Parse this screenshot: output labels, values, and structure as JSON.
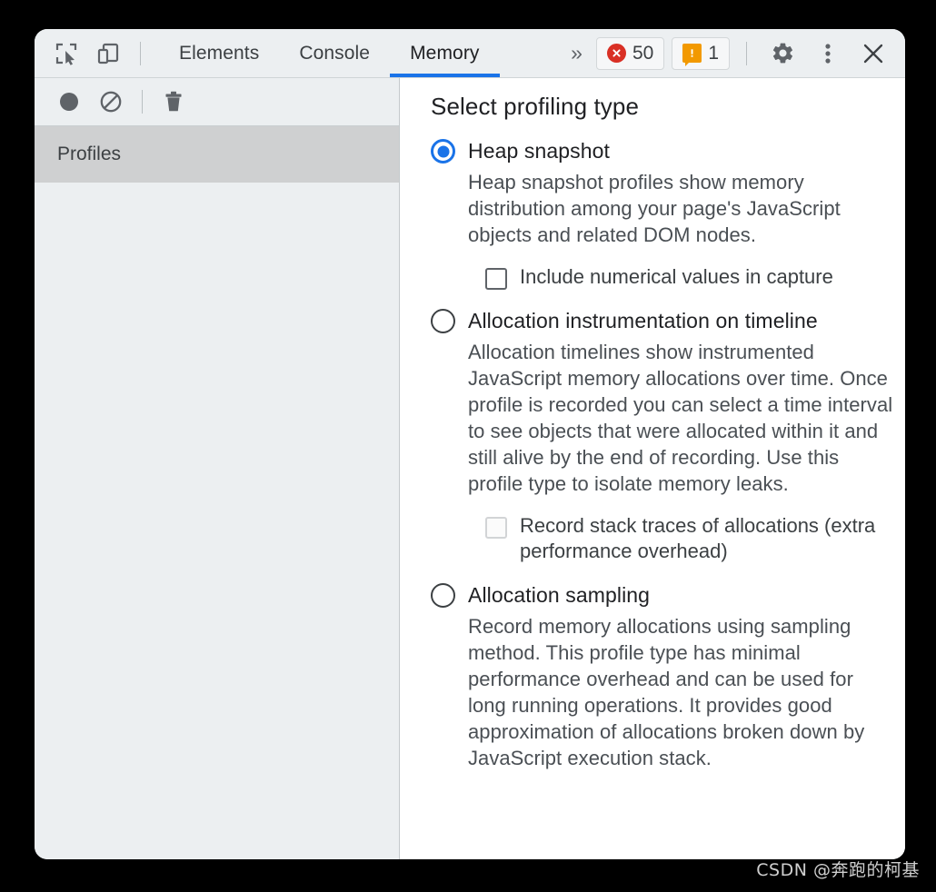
{
  "window": {
    "title": "Chrome DevTools"
  },
  "tabbar": {
    "inspect_icon": "inspect-element-icon",
    "device_icon": "device-toolbar-icon",
    "tabs": [
      {
        "label": "Elements",
        "active": false
      },
      {
        "label": "Console",
        "active": false
      },
      {
        "label": "Memory",
        "active": true
      }
    ],
    "more_tabs_label": "»",
    "errors": {
      "icon": "error-icon",
      "count": "50"
    },
    "warnings": {
      "icon": "warning-icon",
      "count": "1"
    },
    "settings_icon": "gear-icon",
    "menu_icon": "kebab-menu-icon",
    "close_icon": "close-icon",
    "active_underline_color": "#1a73e8"
  },
  "sidebar": {
    "toolbar": {
      "record_icon": "record-circle-icon",
      "clear_icon": "clear-prohibited-icon",
      "trash_icon": "trash-icon"
    },
    "items": [
      {
        "label": "Profiles",
        "selected": true
      }
    ]
  },
  "main": {
    "title": "Select profiling type",
    "options": [
      {
        "id": "heap-snapshot",
        "label": "Heap snapshot",
        "selected": true,
        "description": "Heap snapshot profiles show memory distribution among your page's JavaScript objects and related DOM nodes.",
        "checkbox": {
          "label": "Include numerical values in capture",
          "checked": false,
          "dim": false
        }
      },
      {
        "id": "allocation-instrumentation-on-timeline",
        "label": "Allocation instrumentation on timeline",
        "selected": false,
        "description": "Allocation timelines show instrumented JavaScript memory allocations over time. Once profile is recorded you can select a time interval to see objects that were allocated within it and still alive by the end of recording. Use this profile type to isolate memory leaks.",
        "checkbox": {
          "label": "Record stack traces of allocations (extra performance overhead)",
          "checked": false,
          "dim": true
        }
      },
      {
        "id": "allocation-sampling",
        "label": "Allocation sampling",
        "selected": false,
        "description": "Record memory allocations using sampling method. This profile type has minimal performance overhead and can be used for long running operations. It provides good approximation of allocations broken down by JavaScript execution stack.",
        "checkbox": null
      }
    ]
  },
  "watermark": {
    "text": "CSDN @奔跑的柯基"
  }
}
